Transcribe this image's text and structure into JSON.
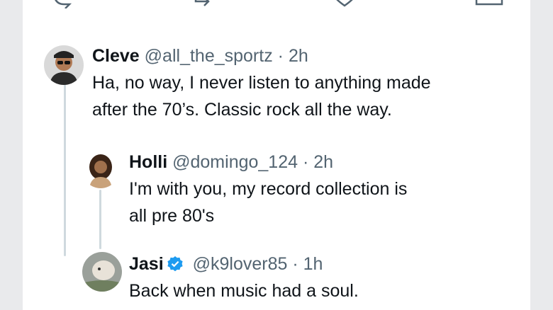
{
  "colors": {
    "text": "#0f1419",
    "muted": "#536471",
    "thread_line": "#cfd9de",
    "verified": "#1d9bf0",
    "background": "#e9eaec",
    "card": "#ffffff"
  },
  "top_actions": [
    {
      "icon": "reply-icon"
    },
    {
      "icon": "retweet-icon"
    },
    {
      "icon": "like-icon"
    },
    {
      "icon": "share-icon"
    }
  ],
  "replies": [
    {
      "name": "Cleve",
      "handle": "@all_the_sportz",
      "separator": "·",
      "time": "2h",
      "text": "Ha, no way, I never listen to anything made\nafter the 70’s. Classic rock all the way.",
      "avatar_icon": "avatar-cleve",
      "verified": false
    },
    {
      "name": "Holli",
      "handle": "@domingo_124",
      "separator": "·",
      "time": "2h",
      "text": "I'm with you, my record collection is\nall pre 80's",
      "avatar_icon": "avatar-holli",
      "verified": false
    },
    {
      "name": "Jasi",
      "handle": "@k9lover85",
      "separator": "·",
      "time": "1h",
      "text": "Back when music had a soul.",
      "avatar_icon": "avatar-jasi",
      "verified": true
    }
  ]
}
